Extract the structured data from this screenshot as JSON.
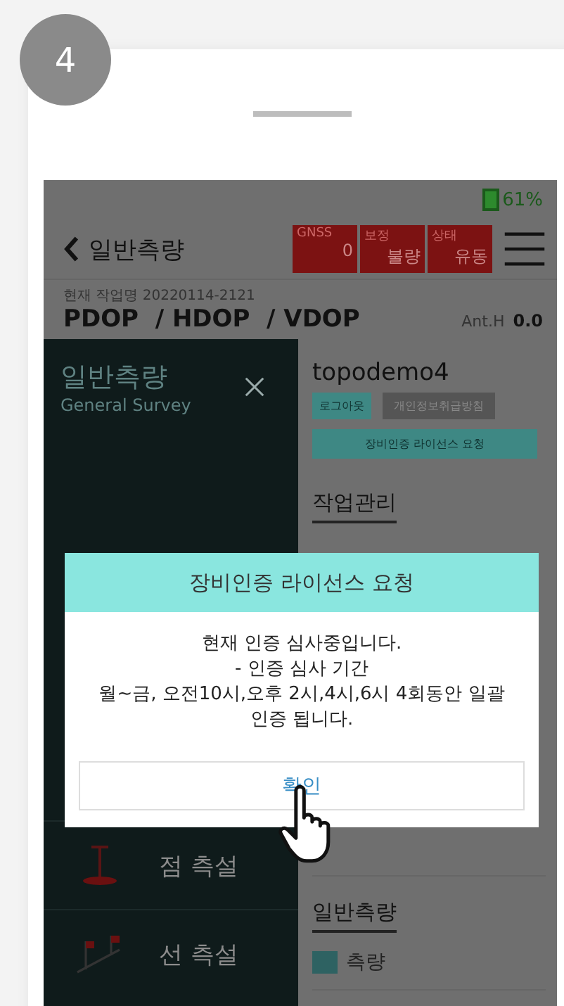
{
  "step_badge": "4",
  "phone": {
    "status_bar": {
      "battery": "61%"
    },
    "header": {
      "title": "일반측량",
      "indicators": [
        {
          "label": "GNSS",
          "value": "0"
        },
        {
          "label": "보정",
          "value": "불량"
        },
        {
          "label": "상태",
          "value": "유동"
        }
      ]
    },
    "job": "현재 작업명 20220114-2121",
    "dop": {
      "label": "PDOP  / HDOP  / VDOP",
      "ant_label": "Ant.H",
      "ant_value": "0.0"
    },
    "drawer": {
      "title": "일반측량",
      "subtitle": "General Survey",
      "items": [
        {
          "label": "점 측설",
          "kind": "point"
        },
        {
          "label": "선 측설",
          "kind": "line"
        }
      ]
    },
    "account": {
      "user": "topodemo4",
      "buttons": [
        {
          "label": "로그아웃",
          "kind": "primary"
        },
        {
          "label": "개인정보취급방침",
          "kind": "secondary"
        }
      ],
      "license_button": "장비인증 라이선스 요청"
    },
    "work_section": {
      "title": "작업관리"
    },
    "survey_section": {
      "title": "일반측량",
      "items": [
        {
          "label": "측량"
        }
      ]
    }
  },
  "dialog": {
    "title": "장비인증 라이선스 요청",
    "message": "현재 인증 심사중입니다.\n- 인증 심사 기간\n월~금, 오전10시,오후 2시,4시,6시 4회동안 일괄\n인증 됩니다.",
    "button": "확인"
  }
}
